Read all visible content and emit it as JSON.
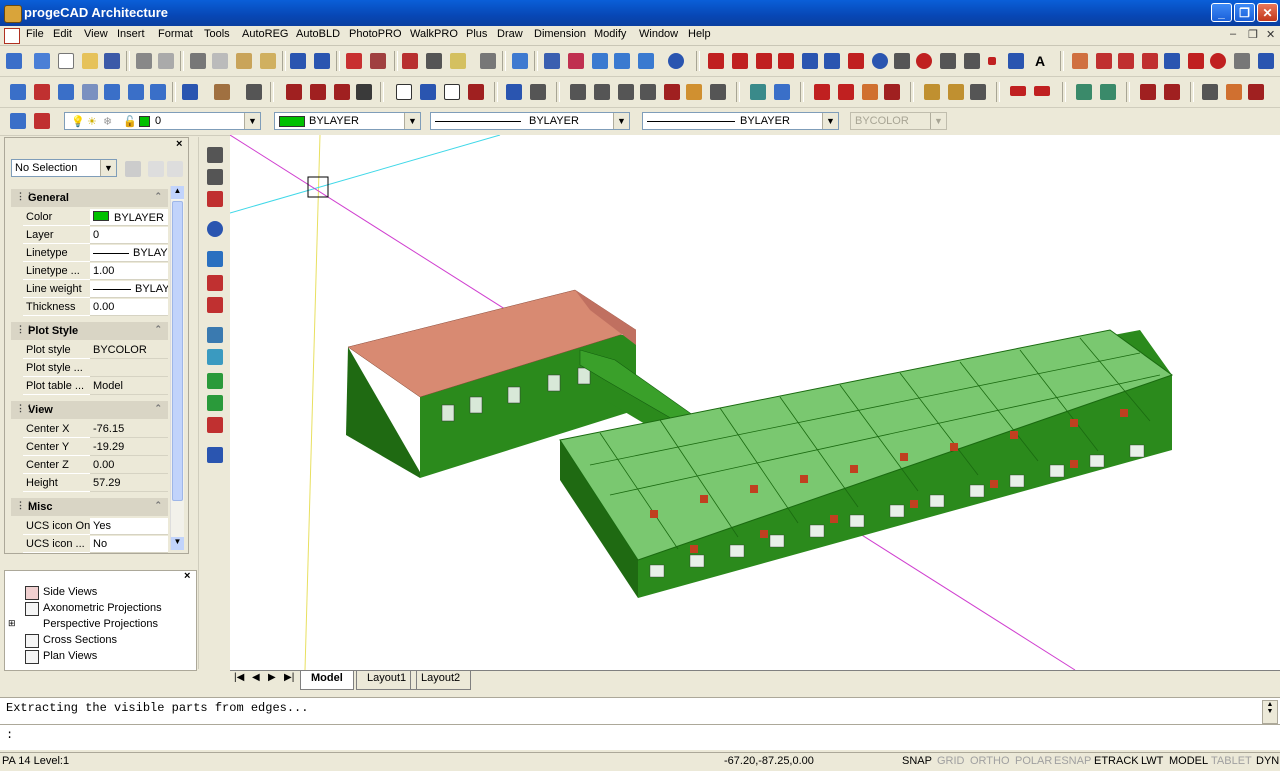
{
  "window": {
    "title": "progeCAD Architecture"
  },
  "menu": [
    "File",
    "Edit",
    "View",
    "Insert",
    "Format",
    "Tools",
    "AutoREG",
    "AutoBLD",
    "PhotoPRO",
    "WalkPRO",
    "Plus",
    "Draw",
    "Dimension",
    "Modify",
    "Window",
    "Help"
  ],
  "layer_toolbar": {
    "layer_value": "0",
    "color_value": "BYLAYER",
    "linetype_value": "BYLAYER",
    "lineweight_value": "BYLAYER",
    "plotstyle_value": "BYCOLOR"
  },
  "properties": {
    "selection": "No Selection",
    "sections": {
      "general": {
        "title": "General",
        "rows": [
          {
            "key": "Color",
            "value": "BYLAYER"
          },
          {
            "key": "Layer",
            "value": "0"
          },
          {
            "key": "Linetype",
            "value": "BYLAYER"
          },
          {
            "key": "Linetype ...",
            "value": "1.00"
          },
          {
            "key": "Line weight",
            "value": "BYLAYER"
          },
          {
            "key": "Thickness",
            "value": "0.00"
          }
        ]
      },
      "plot": {
        "title": "Plot Style",
        "rows": [
          {
            "key": "Plot style",
            "value": "BYCOLOR"
          },
          {
            "key": "Plot style ...",
            "value": ""
          },
          {
            "key": "Plot table ...",
            "value": "Model"
          }
        ]
      },
      "view": {
        "title": "View",
        "rows": [
          {
            "key": "Center X",
            "value": "-76.15"
          },
          {
            "key": "Center Y",
            "value": "-19.29"
          },
          {
            "key": "Center Z",
            "value": "0.00"
          },
          {
            "key": "Height",
            "value": "57.29"
          }
        ]
      },
      "misc": {
        "title": "Misc",
        "rows": [
          {
            "key": "UCS icon On",
            "value": "Yes"
          },
          {
            "key": "UCS icon ...",
            "value": "No"
          }
        ]
      }
    }
  },
  "tree": {
    "items": [
      {
        "label": "Side Views"
      },
      {
        "label": "Axonometric Projections"
      },
      {
        "label": "Perspective Projections"
      },
      {
        "label": "Cross Sections"
      },
      {
        "label": "Plan Views"
      }
    ]
  },
  "tabs": [
    "Model",
    "Layout1",
    "Layout2"
  ],
  "command": {
    "history": "Extracting the visible parts from edges...",
    "prompt": ":"
  },
  "status": {
    "left": "PA 14 Level:1",
    "coords": "-67.20,-87.25,0.00",
    "buttons": [
      {
        "label": "SNAP",
        "on": true
      },
      {
        "label": "GRID",
        "on": false
      },
      {
        "label": "ORTHO",
        "on": false
      },
      {
        "label": "POLAR",
        "on": false
      },
      {
        "label": "ESNAP",
        "on": false
      },
      {
        "label": "ETRACK",
        "on": true
      },
      {
        "label": "LWT",
        "on": true
      },
      {
        "label": "MODEL",
        "on": true
      },
      {
        "label": "TABLET",
        "on": false
      },
      {
        "label": "DYN",
        "on": true
      }
    ]
  },
  "colors": {
    "building_green": "#2d8a1e",
    "roof": "#d08870",
    "titlebar": "#0a5fd8"
  }
}
